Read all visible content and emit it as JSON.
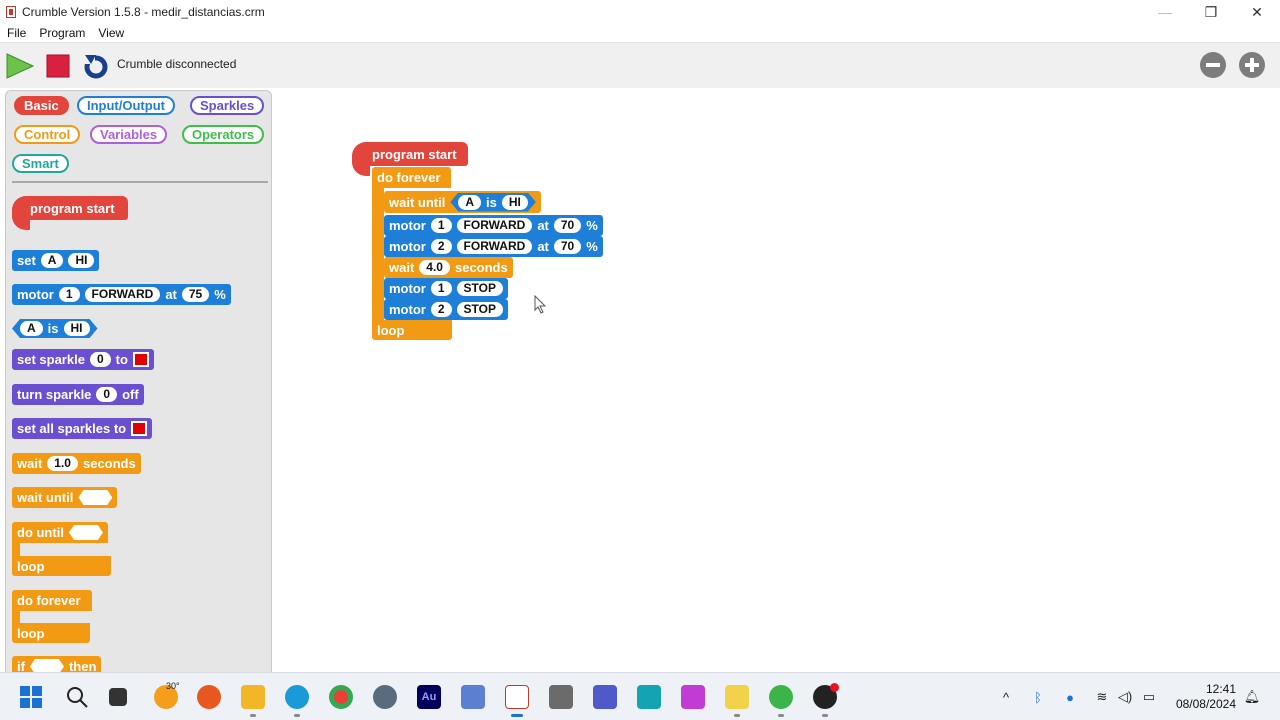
{
  "window": {
    "title": "Crumble Version 1.5.8 - medir_distancias.crm",
    "controls": {
      "minimize": "—",
      "maximize": "❐",
      "close": "✕"
    }
  },
  "menu": [
    "File",
    "Program",
    "View"
  ],
  "toolbar": {
    "status": "Crumble disconnected",
    "icons": [
      "play-icon",
      "stop-icon",
      "connect-icon",
      "zoom-out-icon",
      "zoom-in-icon"
    ]
  },
  "palette": {
    "categories": [
      {
        "label": "Basic",
        "color": "#e2453b",
        "active": true
      },
      {
        "label": "Input/Output",
        "color": "#1e7fd9"
      },
      {
        "label": "Sparkles",
        "color": "#6a4fd0"
      },
      {
        "label": "Control",
        "color": "#f39a14"
      },
      {
        "label": "Variables",
        "color": "#b05fd6"
      },
      {
        "label": "Operators",
        "color": "#3cc04a"
      },
      {
        "label": "Smart",
        "color": "#1fa8a0"
      }
    ],
    "blocks": {
      "program_start": "program start",
      "set": {
        "label": "set",
        "pin": "A",
        "value": "HI"
      },
      "motor": {
        "label": "motor",
        "num": "1",
        "dir": "FORWARD",
        "at": "at",
        "speed": "75",
        "unit": "%"
      },
      "pin_is": {
        "pin": "A",
        "is": "is",
        "value": "HI"
      },
      "set_sparkle": {
        "label": "set sparkle",
        "num": "0",
        "to": "to"
      },
      "turn_sparkle": {
        "label": "turn sparkle",
        "num": "0",
        "off": "off"
      },
      "set_all_sparkles": {
        "label": "set all sparkles to"
      },
      "wait": {
        "label": "wait",
        "value": "1.0",
        "unit": "seconds"
      },
      "wait_until": {
        "label": "wait until"
      },
      "do_until": {
        "label": "do until",
        "loop": "loop"
      },
      "do_forever": {
        "label": "do forever",
        "loop": "loop"
      },
      "if": {
        "label": "if",
        "then": "then"
      }
    }
  },
  "program": {
    "start": "program start",
    "forever": "do forever",
    "wait_until": {
      "label": "wait until",
      "pin": "A",
      "is": "is",
      "value": "HI"
    },
    "motor1": {
      "label": "motor",
      "num": "1",
      "dir": "FORWARD",
      "at": "at",
      "speed": "70",
      "unit": "%"
    },
    "motor2": {
      "label": "motor",
      "num": "2",
      "dir": "FORWARD",
      "at": "at",
      "speed": "70",
      "unit": "%"
    },
    "wait": {
      "label": "wait",
      "value": "4.0",
      "unit": "seconds"
    },
    "stop1": {
      "label": "motor",
      "num": "1",
      "state": "STOP"
    },
    "stop2": {
      "label": "motor",
      "num": "2",
      "state": "STOP"
    },
    "loop": "loop"
  },
  "taskbar": {
    "weather": "30°",
    "au_label": "Au",
    "clock_time": "12:41",
    "clock_date": "08/08/2024"
  },
  "colors": {
    "io_blue": "#1e7fd9",
    "control_orange": "#f39a14",
    "basic_red": "#e2453b",
    "sparkle_purple": "#6a4fd0"
  }
}
